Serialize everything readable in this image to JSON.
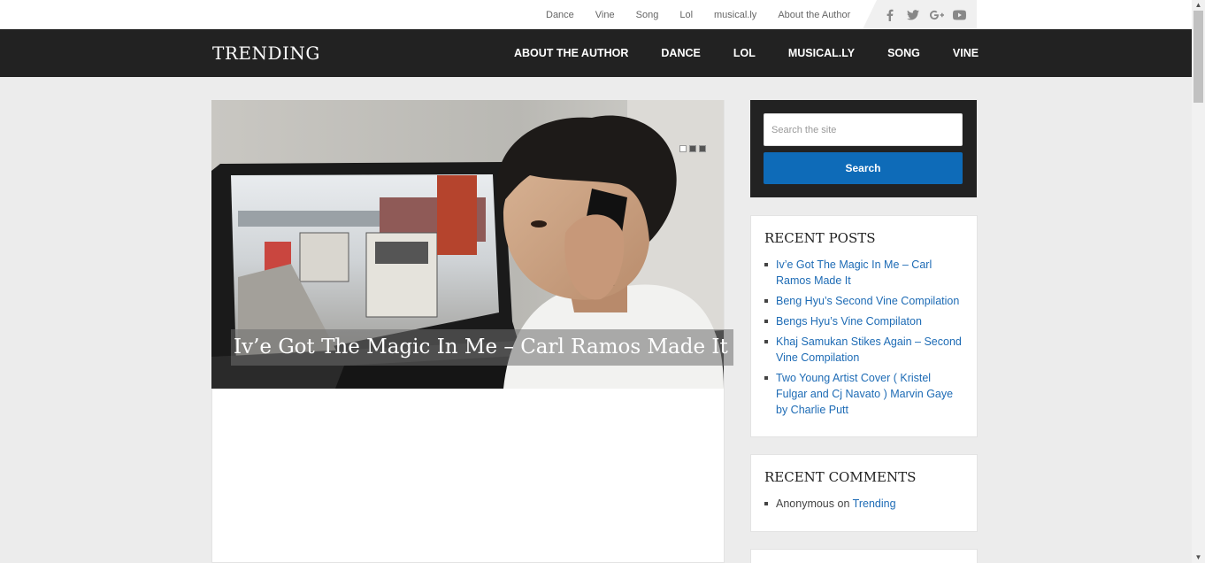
{
  "top_nav": [
    "Dance",
    "Vine",
    "Song",
    "Lol",
    "musical.ly",
    "About the Author"
  ],
  "social": [
    "facebook-icon",
    "twitter-icon",
    "google-plus-icon",
    "youtube-icon"
  ],
  "site_title": "TRENDING",
  "main_nav": [
    "ABOUT THE AUTHOR",
    "DANCE",
    "LOL",
    "MUSICAL.LY",
    "SONG",
    "VINE"
  ],
  "hero": {
    "caption": "Iv’e Got The Magic In Me – Carl Ramos Made It"
  },
  "search": {
    "placeholder": "Search the site",
    "button": "Search"
  },
  "recent_posts": {
    "title": "RECENT POSTS",
    "items": [
      "Iv’e Got The Magic In Me – Carl Ramos Made It",
      "Beng Hyu’s Second Vine Compilation",
      "Bengs Hyu’s Vine Compilaton",
      "Khaj Samukan Stikes Again – Second Vine Compilation",
      "Two Young Artist Cover ( Kristel Fulgar and Cj Navato ) Marvin Gaye by Charlie Putt"
    ]
  },
  "recent_comments": {
    "title": "RECENT COMMENTS",
    "author": "Anonymous",
    "on": "on",
    "link": "Trending"
  },
  "colors": {
    "header_bg": "#222222",
    "accent": "#0e6bb8",
    "link": "#1d6bb5",
    "page_bg": "#ececec"
  }
}
